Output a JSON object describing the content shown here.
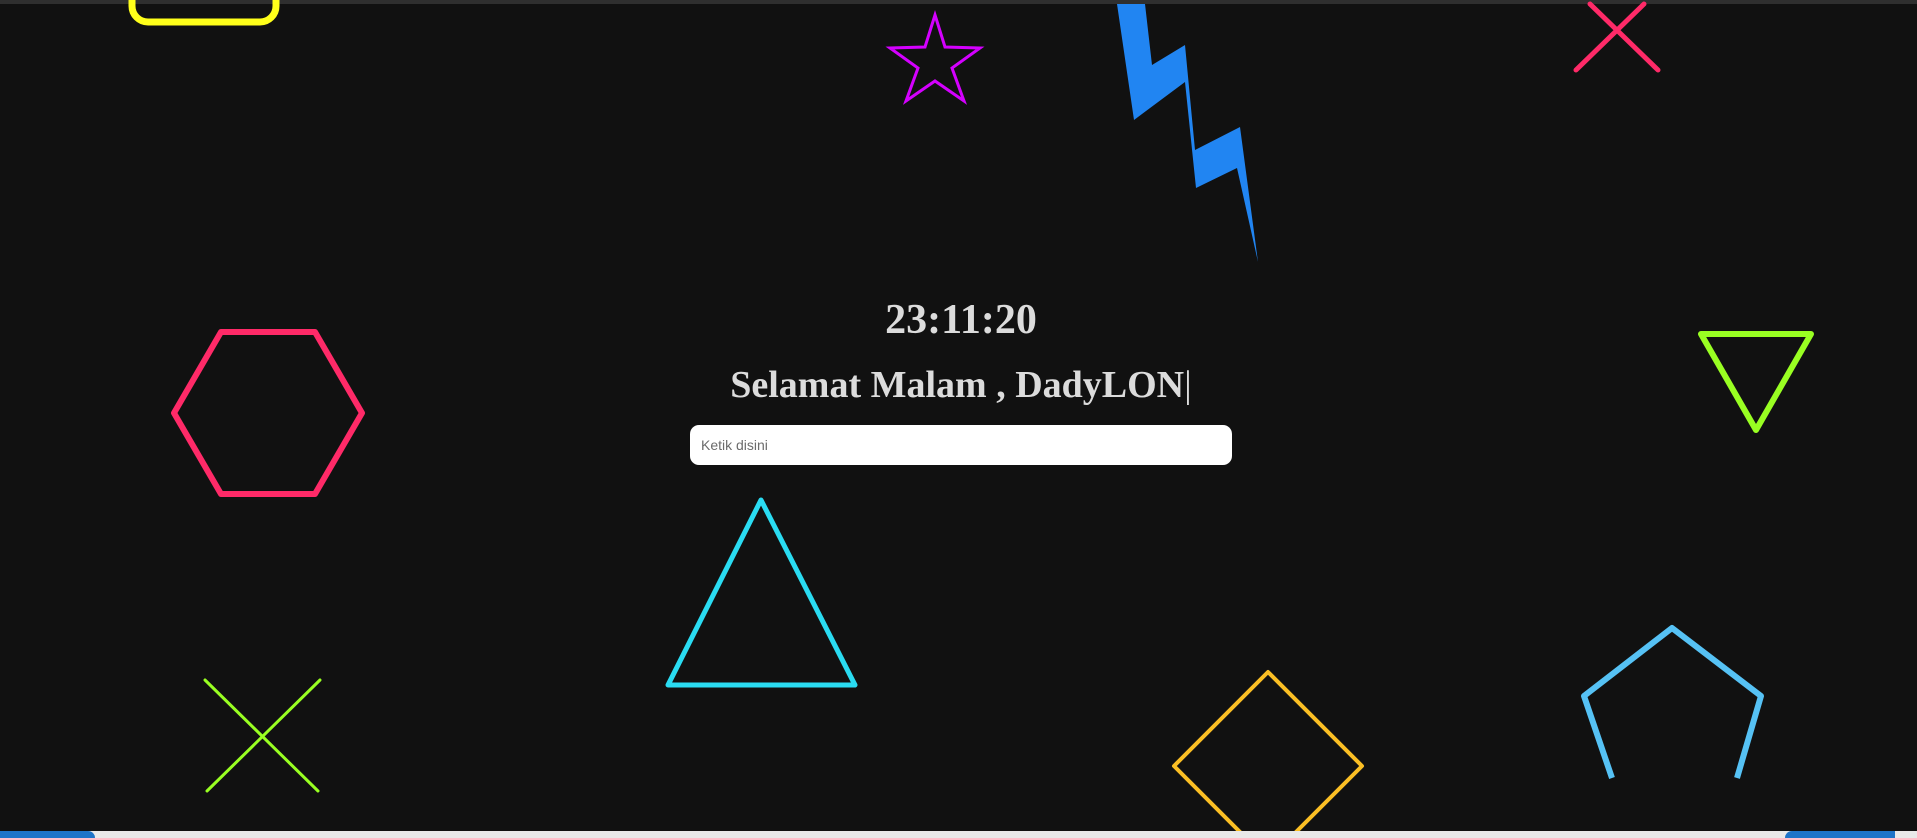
{
  "clock": {
    "time": "23:11:20"
  },
  "greeting": {
    "text": "Selamat Malam , DadyLON",
    "cursor": "|"
  },
  "search": {
    "placeholder": "Ketik disini",
    "value": ""
  },
  "colors": {
    "background": "#111111",
    "text": "#dcdcdc",
    "yellow": "#ffff1a",
    "magenta": "#d400ff",
    "blue": "#2185f2",
    "pink": "#ff2a68",
    "lime": "#99ff22",
    "cyan": "#2adcf2",
    "orange": "#fbbf24",
    "sky": "#56c2f5"
  },
  "decorations": [
    "rounded-rectangle-outline",
    "star-outline",
    "lightning-bolt",
    "x-mark",
    "hexagon-outline",
    "down-triangle-outline",
    "triangle-outline",
    "x-mark",
    "diamond-outline",
    "pentagon-outline"
  ]
}
